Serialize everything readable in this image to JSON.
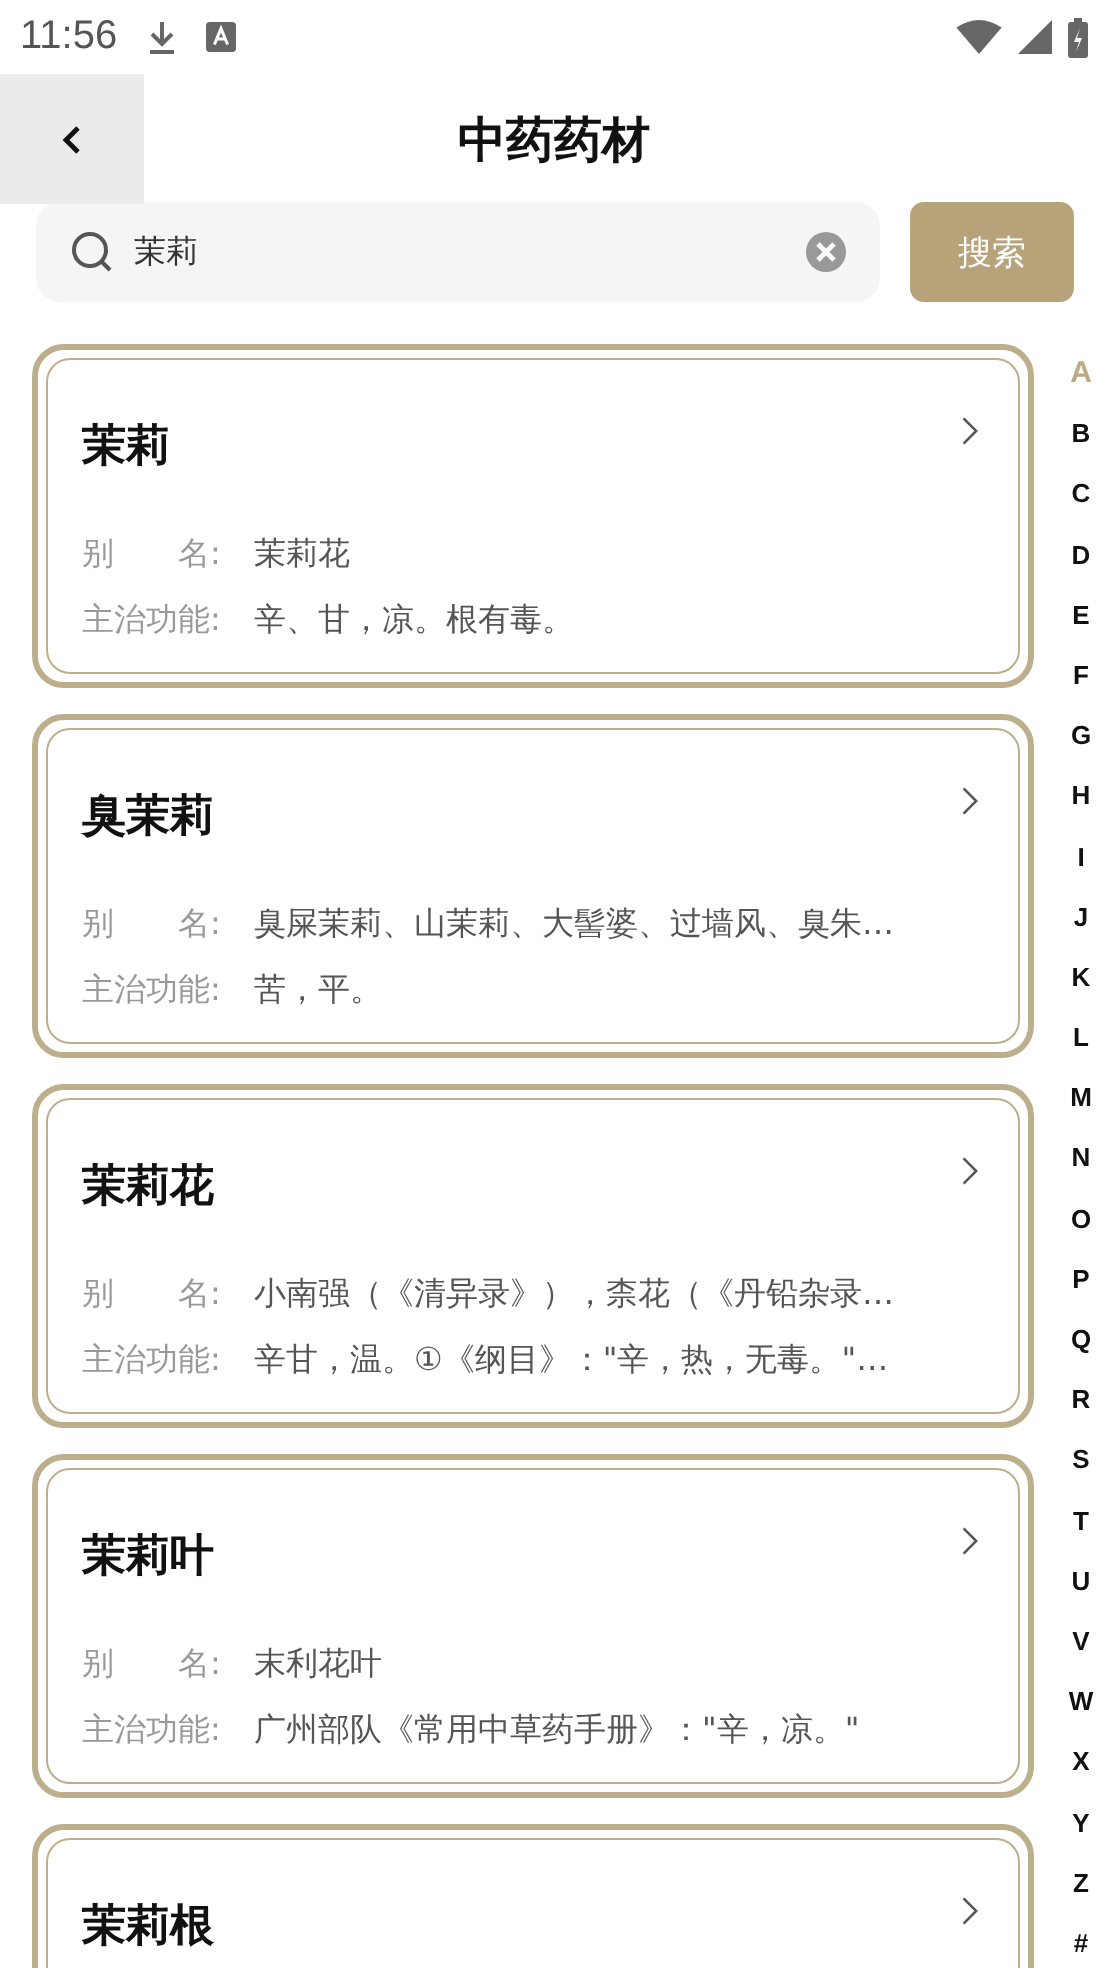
{
  "status_bar": {
    "time": "11:56"
  },
  "header": {
    "title": "中药药材"
  },
  "search": {
    "value": "茉莉",
    "button": "搜索"
  },
  "cards": [
    {
      "title": "茉莉",
      "fields": [
        {
          "label": "别　　名:",
          "value": "茉莉花"
        },
        {
          "label": "主治功能:",
          "value": "辛、甘，凉。根有毒。"
        }
      ]
    },
    {
      "title": "臭茉莉",
      "fields": [
        {
          "label": "别　　名:",
          "value": "臭屎茉莉、山茉莉、大髻婆、过墙风、臭朱…"
        },
        {
          "label": "主治功能:",
          "value": "苦，平。"
        }
      ]
    },
    {
      "title": "茉莉花",
      "fields": [
        {
          "label": "别　　名:",
          "value": "小南强（《清异录》），柰花（《丹铅杂录…"
        },
        {
          "label": "主治功能:",
          "value": "辛甘，温。①《纲目》：\"辛，热，无毒。\"…"
        }
      ]
    },
    {
      "title": "茉莉叶",
      "fields": [
        {
          "label": "别　　名:",
          "value": "末利花叶"
        },
        {
          "label": "主治功能:",
          "value": "广州部队《常用中草药手册》：\"辛，凉。\""
        }
      ]
    },
    {
      "title": "茉莉根"
    }
  ],
  "index": [
    {
      "label": "A",
      "selected": true
    },
    {
      "label": "B",
      "selected": false
    },
    {
      "label": "C",
      "selected": false
    },
    {
      "label": "D",
      "selected": false
    },
    {
      "label": "E",
      "selected": false
    },
    {
      "label": "F",
      "selected": false
    },
    {
      "label": "G",
      "selected": false
    },
    {
      "label": "H",
      "selected": false
    },
    {
      "label": "I",
      "selected": false
    },
    {
      "label": "J",
      "selected": false
    },
    {
      "label": "K",
      "selected": false
    },
    {
      "label": "L",
      "selected": false
    },
    {
      "label": "M",
      "selected": false
    },
    {
      "label": "N",
      "selected": false
    },
    {
      "label": "O",
      "selected": false
    },
    {
      "label": "P",
      "selected": false
    },
    {
      "label": "Q",
      "selected": false
    },
    {
      "label": "R",
      "selected": false
    },
    {
      "label": "S",
      "selected": false
    },
    {
      "label": "T",
      "selected": false
    },
    {
      "label": "U",
      "selected": false
    },
    {
      "label": "V",
      "selected": false
    },
    {
      "label": "W",
      "selected": false
    },
    {
      "label": "X",
      "selected": false
    },
    {
      "label": "Y",
      "selected": false
    },
    {
      "label": "Z",
      "selected": false
    },
    {
      "label": "#",
      "selected": false
    }
  ]
}
